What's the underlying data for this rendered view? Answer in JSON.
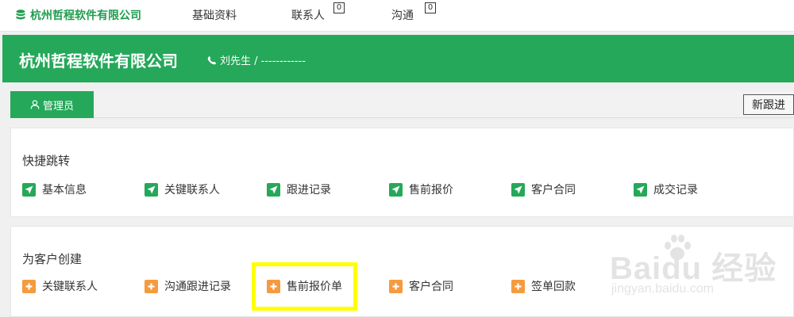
{
  "topnav": {
    "brand": "杭州哲程软件有限公司",
    "items": [
      {
        "label": "基础资料"
      },
      {
        "label": "联系人",
        "count": "0"
      },
      {
        "label": "沟通",
        "count": "0"
      }
    ]
  },
  "header": {
    "company": "杭州哲程软件有限公司",
    "contact": "刘先生 / ------------"
  },
  "tabbar": {
    "active_tab": "管理员",
    "new_button": "新跟进"
  },
  "quick_jump": {
    "title": "快捷跳转",
    "links": [
      {
        "label": "基本信息"
      },
      {
        "label": "关键联系人"
      },
      {
        "label": "跟进记录"
      },
      {
        "label": "售前报价"
      },
      {
        "label": "客户合同"
      },
      {
        "label": "成交记录"
      }
    ]
  },
  "create_for_customer": {
    "title": "为客户创建",
    "links": [
      {
        "label": "关键联系人"
      },
      {
        "label": "沟通跟进记录"
      },
      {
        "label": "售前报价单"
      },
      {
        "label": "客户合同"
      },
      {
        "label": "签单回款"
      }
    ]
  },
  "watermark": {
    "brand": "Baidu 经验",
    "url": "jingyan.baidu.com"
  },
  "colors": {
    "primary_green": "#25a85a",
    "brand_green": "#1f9d4f",
    "orange_icon": "#f59a3f",
    "highlight": "#ffff00"
  }
}
